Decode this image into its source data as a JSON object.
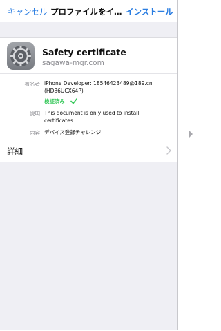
{
  "nav": {
    "cancel": "キャンセル",
    "title": "プロファイルをイ…",
    "install": "インストール"
  },
  "profile": {
    "icon": "settings-gear-icon",
    "name": "Safety certificate",
    "domain": "sagawa-mqr.com",
    "signer_label": "署名者",
    "signer_value_line1": "iPhone Developer: 18546423489@189.cn",
    "signer_value_line2": "(HD86UCX64P)",
    "verified_label": "検証済み",
    "description_label": "説明",
    "description_value_line1": "This document is only used to install",
    "description_value_line2": "certificates",
    "contents_label": "内容",
    "contents_value": "デバイス登録チャレンジ"
  },
  "details": {
    "label": "詳細"
  },
  "colors": {
    "accent": "#2a7de1",
    "verified": "#35c759",
    "background": "#efeff4"
  }
}
